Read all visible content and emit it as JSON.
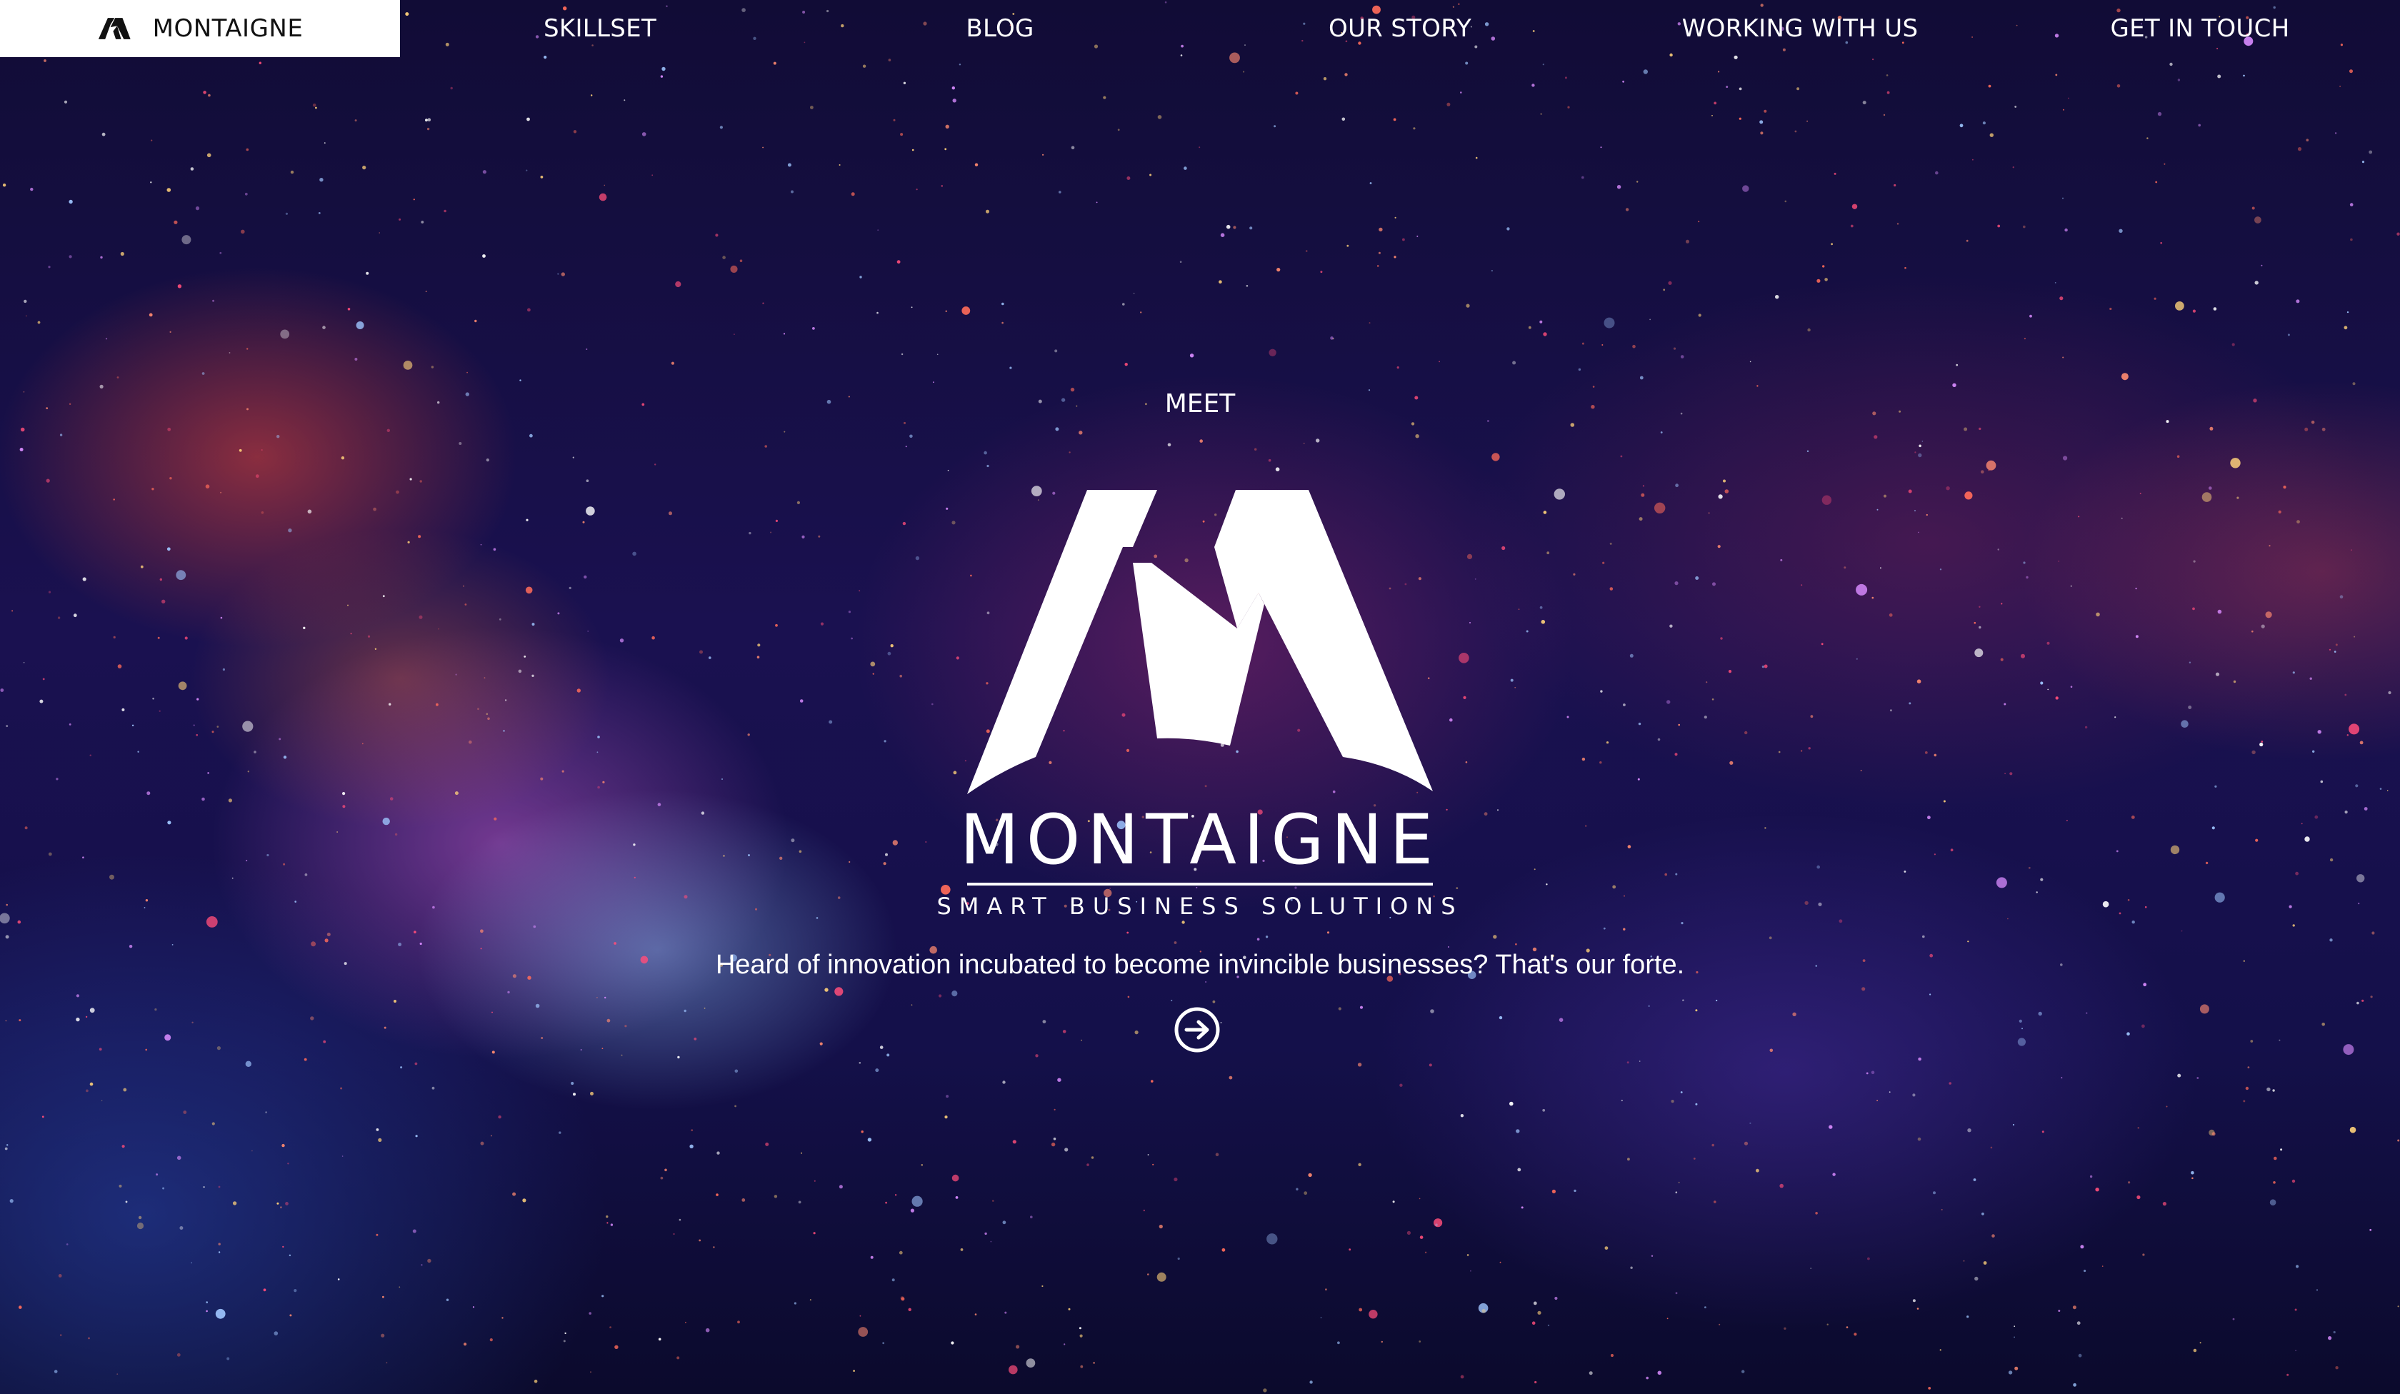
{
  "nav": {
    "brand": {
      "icon": "montaigne-m-logo-icon",
      "label": "MONTAIGNE"
    },
    "items": [
      {
        "label": "SKILLSET"
      },
      {
        "label": "BLOG"
      },
      {
        "label": "OUR STORY"
      },
      {
        "label": "WORKING WITH US"
      },
      {
        "label": "GET IN TOUCH"
      }
    ]
  },
  "hero": {
    "eyebrow": "MEET",
    "logo_icon": "montaigne-m-logo-icon",
    "wordmark": "MONTAIGNE",
    "tagline": "SMART BUSINESS SOLUTIONS",
    "subtitle": "Heard of innovation incubated to become invincible businesses? That's our forte.",
    "cta_icon": "arrow-right-circle-icon"
  },
  "colors": {
    "nav_brand_bg": "#ffffff",
    "text_on_dark": "#ffffff",
    "background": "#1a1150"
  }
}
